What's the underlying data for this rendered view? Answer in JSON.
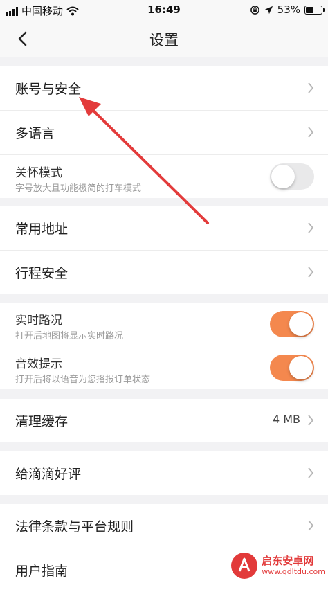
{
  "status_bar": {
    "carrier": "中国移动",
    "time": "16:49",
    "battery_percent": "53%",
    "battery_level": 0.53,
    "icons": [
      "signal-icon",
      "wifi-icon",
      "orientation-lock-icon",
      "location-icon",
      "battery-icon"
    ]
  },
  "nav": {
    "title": "设置",
    "back_icon": "chevron-left-icon"
  },
  "groups": {
    "account": [
      {
        "label": "账号与安全"
      },
      {
        "label": "多语言"
      },
      {
        "label": "关怀模式",
        "sub": "字号放大且功能极简的打车模式",
        "toggle": "off"
      }
    ],
    "trip": [
      {
        "label": "常用地址"
      },
      {
        "label": "行程安全"
      }
    ],
    "features": [
      {
        "label": "实时路况",
        "sub": "打开后地图将显示实时路况",
        "toggle": "on"
      },
      {
        "label": "音效提示",
        "sub": "打开后将以语音为您播报订单状态",
        "toggle": "on"
      }
    ],
    "cache": [
      {
        "label": "清理缓存",
        "value": "4 MB"
      }
    ],
    "review": [
      {
        "label": "给滴滴好评"
      }
    ],
    "legal": [
      {
        "label": "法律条款与平台规则"
      },
      {
        "label": "用户指南"
      }
    ]
  },
  "watermark": {
    "name": "启东安卓网",
    "url": "www.qdltdu.com"
  },
  "colors": {
    "accent": "#f4884e",
    "annotation_arrow": "#e33b3b",
    "background": "#f2f2f4"
  }
}
